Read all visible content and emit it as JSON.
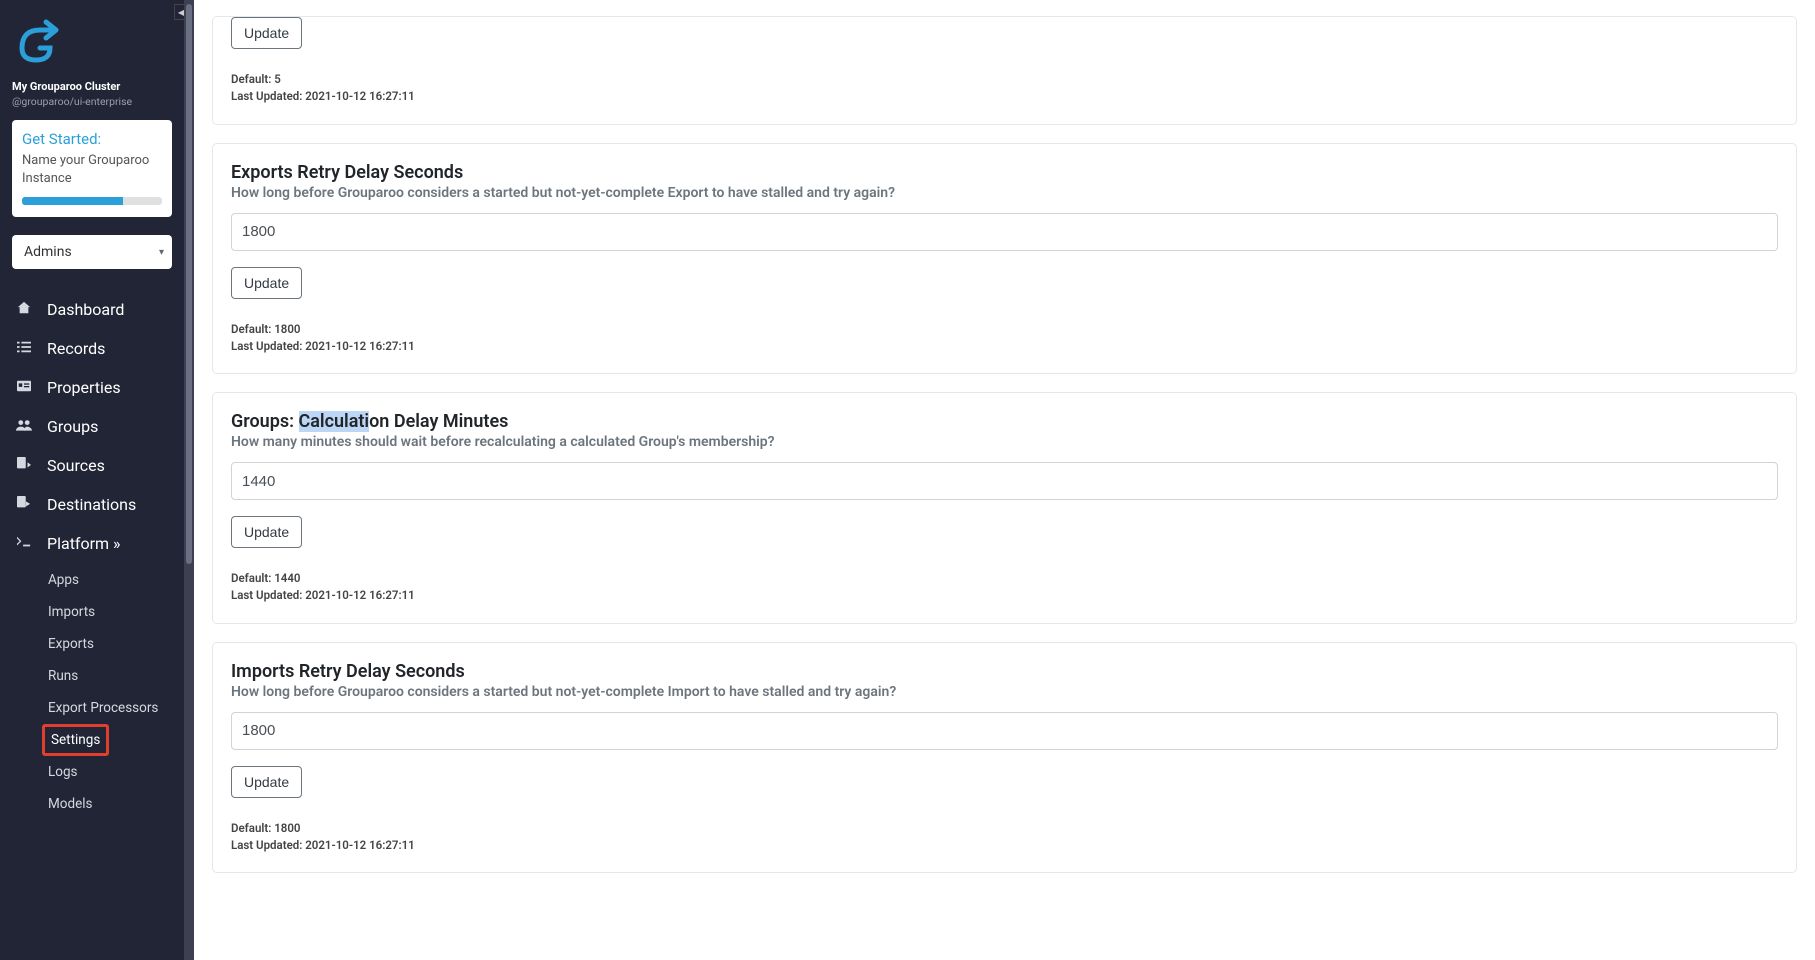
{
  "sidebar": {
    "cluster_name": "My Grouparoo Cluster",
    "package_name": "@grouparoo/ui-enterprise",
    "get_started_title": "Get Started:",
    "get_started_text": "Name your Grouparoo Instance",
    "select_value": "Admins",
    "nav": {
      "dashboard": "Dashboard",
      "records": "Records",
      "properties": "Properties",
      "groups": "Groups",
      "sources": "Sources",
      "destinations": "Destinations",
      "platform": "Platform »"
    },
    "subnav": {
      "apps": "Apps",
      "imports": "Imports",
      "exports": "Exports",
      "runs": "Runs",
      "export_processors": "Export Processors",
      "settings": "Settings",
      "logs": "Logs",
      "models": "Models"
    }
  },
  "labels": {
    "update": "Update",
    "default_prefix": "Default: ",
    "last_updated_prefix": "Last Updated: "
  },
  "settings": {
    "item0": {
      "default": "5",
      "last_updated": "2021-10-12 16:27:11"
    },
    "item1": {
      "title": "Exports Retry Delay Seconds",
      "desc": "How long before Grouparoo considers a started but not-yet-complete Export to have stalled and try again?",
      "value": "1800",
      "default": "1800",
      "last_updated": "2021-10-12 16:27:11"
    },
    "item2": {
      "title_pre": "Groups: ",
      "title_hl": "Calculati",
      "title_post": "on Delay Minutes",
      "desc": "How many minutes should wait before recalculating a calculated Group's membership?",
      "value": "1440",
      "default": "1440",
      "last_updated": "2021-10-12 16:27:11"
    },
    "item3": {
      "title": "Imports Retry Delay Seconds",
      "desc": "How long before Grouparoo considers a started but not-yet-complete Import to have stalled and try again?",
      "value": "1800",
      "default": "1800",
      "last_updated": "2021-10-12 16:27:11"
    }
  }
}
